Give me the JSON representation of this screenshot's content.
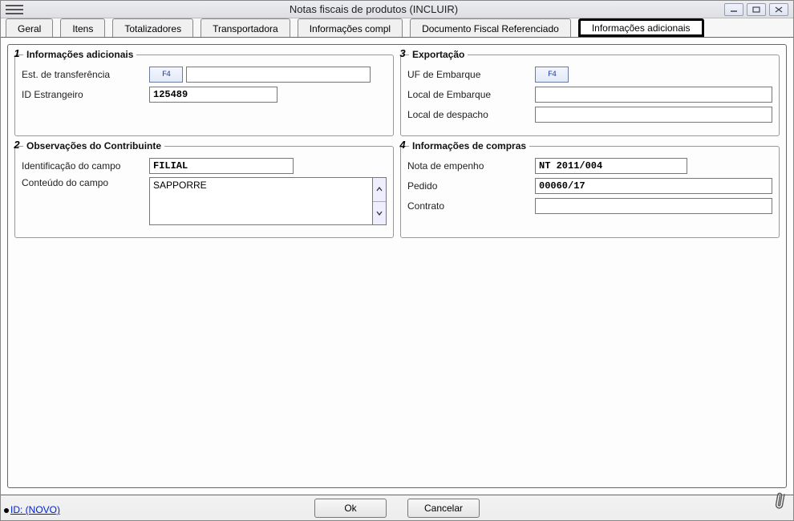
{
  "window": {
    "title": "Notas fiscais de produtos (INCLUIR)"
  },
  "tabs": {
    "t0": "Geral",
    "t1": "Itens",
    "t2": "Totalizadores",
    "t3": "Transportadora",
    "t4": "Informações compl",
    "t5": "Documento Fiscal Referenciado",
    "t6": "Informações adicionais"
  },
  "groups": {
    "g1": {
      "num": "1",
      "title": "Informações adicionais"
    },
    "g2": {
      "num": "2",
      "title": "Observações do Contribuinte"
    },
    "g3": {
      "num": "3",
      "title": "Exportação"
    },
    "g4": {
      "num": "4",
      "title": "Informações de compras"
    }
  },
  "labels": {
    "estTransf": "Est. de transferência",
    "idEstrang": "ID Estrangeiro",
    "identCampo": "Identificação do campo",
    "conteudoCampo": "Conteúdo do campo",
    "ufEmbarque": "UF de Embarque",
    "localEmbarque": "Local de Embarque",
    "localDespacho": "Local de despacho",
    "notaEmpenho": "Nota de empenho",
    "pedido": "Pedido",
    "contrato": "Contrato"
  },
  "values": {
    "estTransfCode": "",
    "estTransfDesc": "",
    "idEstrangeiro": "125489",
    "identCampo": "FILIAL",
    "conteudoCampo": "SAPPORRE",
    "ufEmbarque": "",
    "localEmbarque": "",
    "localDespacho": "",
    "notaEmpenho": "NT 2011/004",
    "pedido": "00060/17",
    "contrato": ""
  },
  "buttons": {
    "ok": "Ok",
    "cancel": "Cancelar",
    "f4": "F4"
  },
  "statusbar": {
    "idLink": "ID: (NOVO)"
  }
}
